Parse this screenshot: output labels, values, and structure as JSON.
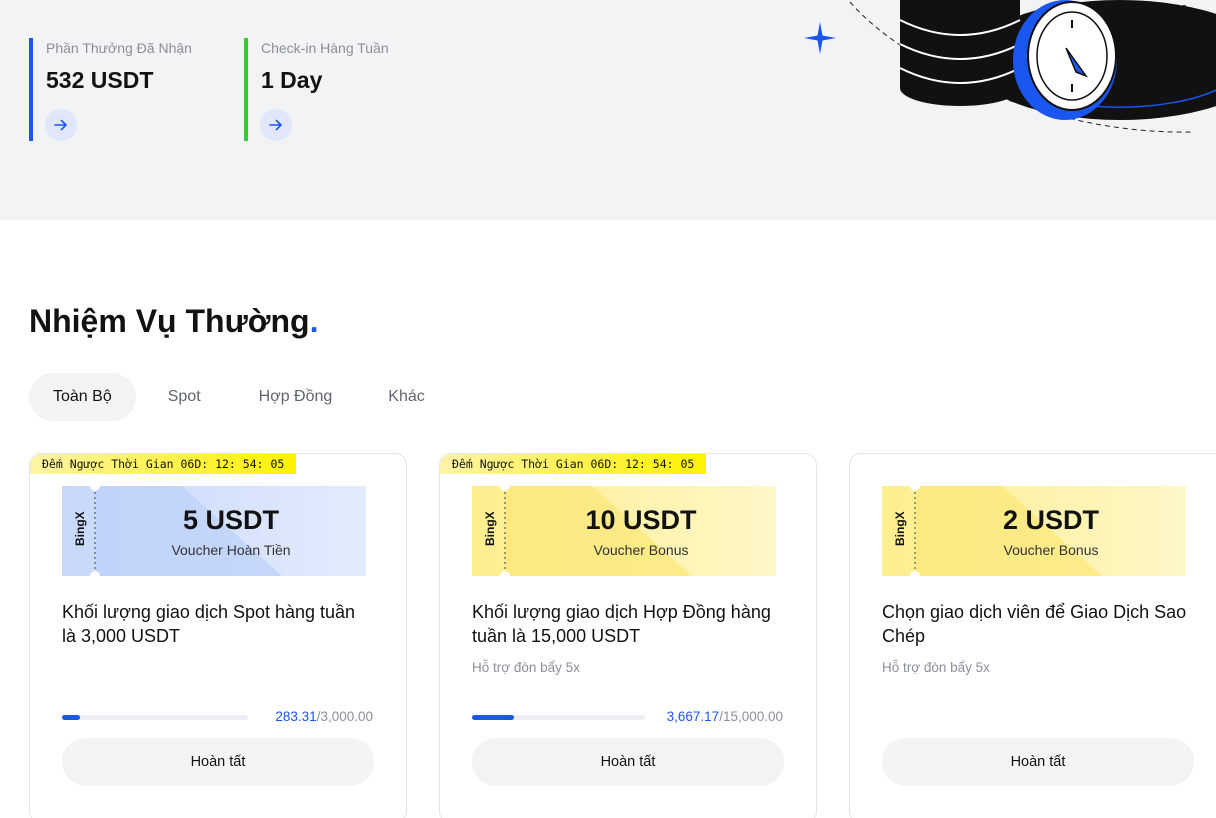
{
  "stats": [
    {
      "label": "Phần Thưởng Đã Nhận",
      "value": "532 USDT",
      "accent": "#1a56f0"
    },
    {
      "label": "Check-in Hàng Tuần",
      "value": "1 Day",
      "accent": "#33cc33"
    }
  ],
  "section": {
    "title": "Nhiệm Vụ Thường",
    "title_dot": "."
  },
  "tabs": [
    {
      "label": "Toàn Bộ",
      "active": true
    },
    {
      "label": "Spot",
      "active": false
    },
    {
      "label": "Hợp Đồng",
      "active": false
    },
    {
      "label": "Khác",
      "active": false
    }
  ],
  "cards": [
    {
      "countdown": "Đếm Ngược Thời Gian 06D: 12: 54: 05",
      "voucher": {
        "brand": "BingX",
        "amount": "5 USDT",
        "type": "Voucher Hoàn Tiền",
        "color": "#c9d9fb"
      },
      "title": "Khối lượng giao dịch Spot hàng tuần là 3,000 USDT",
      "subtitle": "",
      "progress": {
        "current": "283.31",
        "total": "/3,000.00",
        "fraction": 0.0944
      },
      "button": "Hoàn tất"
    },
    {
      "countdown": "Đếm Ngược Thời Gian 06D: 12: 54: 05",
      "voucher": {
        "brand": "BingX",
        "amount": "10 USDT",
        "type": "Voucher Bonus",
        "color": "#fdf09a"
      },
      "title": "Khối lượng giao dịch Hợp Đồng hàng tuần là 15,000 USDT",
      "subtitle": "Hỗ trợ đòn bẩy 5x",
      "progress": {
        "current": "3,667.17",
        "total": "/15,000.00",
        "fraction": 0.2445
      },
      "button": "Hoàn tất"
    },
    {
      "countdown": "",
      "voucher": {
        "brand": "BingX",
        "amount": "2 USDT",
        "type": "Voucher Bonus",
        "color": "#fdf09a"
      },
      "title": "Chọn giao dịch viên để Giao Dịch Sao Chép",
      "subtitle": "Hỗ trợ đòn bẩy 5x",
      "button": "Hoàn tất"
    }
  ]
}
